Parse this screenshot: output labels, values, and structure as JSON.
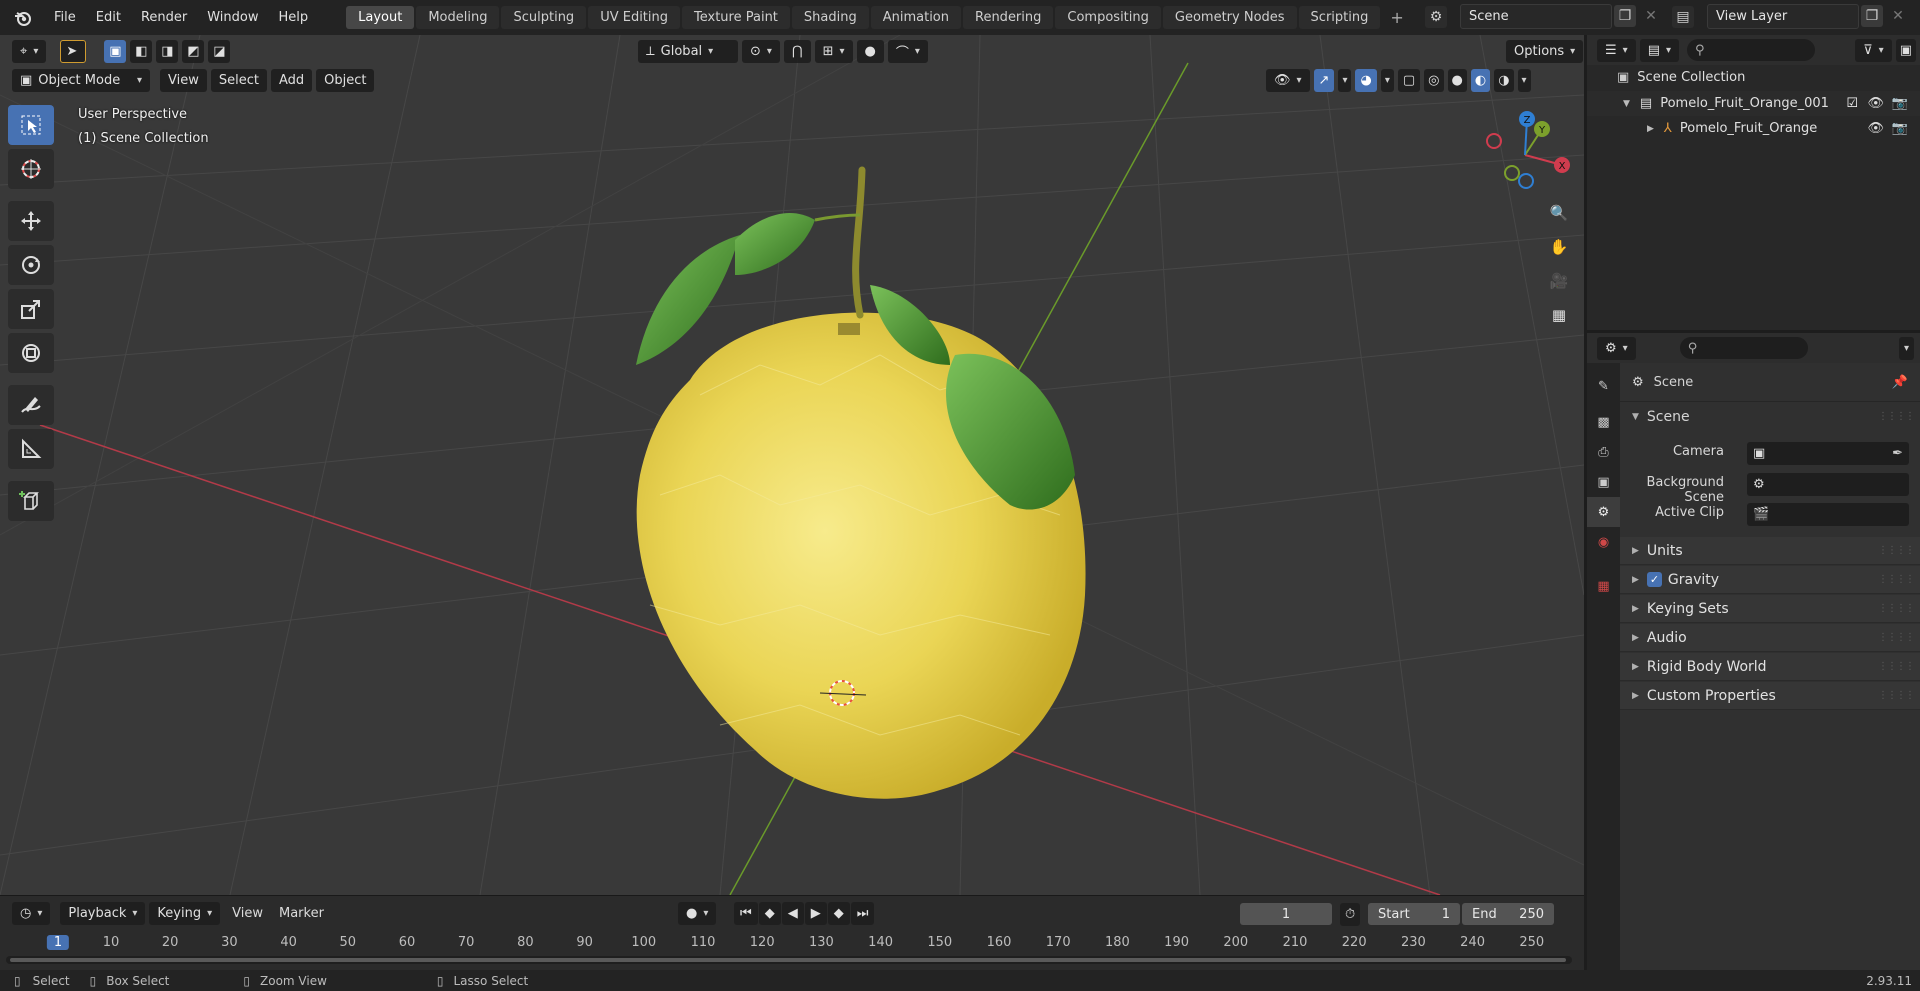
{
  "topbar": {
    "menus": [
      "File",
      "Edit",
      "Render",
      "Window",
      "Help"
    ],
    "workspaces": [
      "Layout",
      "Modeling",
      "Sculpting",
      "UV Editing",
      "Texture Paint",
      "Shading",
      "Animation",
      "Rendering",
      "Compositing",
      "Geometry Nodes",
      "Scripting"
    ],
    "active_workspace": "Layout",
    "scene_name": "Scene",
    "view_layer": "View Layer"
  },
  "viewport": {
    "transform_orientation": "Global",
    "options_label": "Options",
    "mode": "Object Mode",
    "menus": [
      "View",
      "Select",
      "Add",
      "Object"
    ],
    "perspective_text": "User Perspective",
    "collection_text": "(1) Scene Collection",
    "gizmo_axes": {
      "x": "X",
      "y": "Y",
      "z": "Z"
    }
  },
  "outliner": {
    "root": "Scene Collection",
    "collection": "Pomelo_Fruit_Orange_001",
    "object": "Pomelo_Fruit_Orange"
  },
  "properties": {
    "header": "Scene",
    "panel_scene": "Scene",
    "camera_label": "Camera",
    "background_scene_label": "Background Scene",
    "active_clip_label": "Active Clip",
    "panels": [
      "Units",
      "Gravity",
      "Keying Sets",
      "Audio",
      "Rigid Body World",
      "Custom Properties"
    ],
    "gravity_checked": true
  },
  "timeline": {
    "menus": [
      "Playback",
      "Keying",
      "View",
      "Marker"
    ],
    "current_frame": "1",
    "start_label": "Start",
    "start_value": "1",
    "end_label": "End",
    "end_value": "250",
    "ruler_marks": [
      "1",
      "10",
      "20",
      "30",
      "40",
      "50",
      "60",
      "70",
      "80",
      "90",
      "100",
      "110",
      "120",
      "130",
      "140",
      "150",
      "160",
      "170",
      "180",
      "190",
      "200",
      "210",
      "220",
      "230",
      "240",
      "250"
    ]
  },
  "statusbar": {
    "select": "Select",
    "box_select": "Box Select",
    "zoom_view": "Zoom View",
    "lasso_select": "Lasso Select",
    "version": "2.93.11"
  },
  "colors": {
    "accent": "#4772b3",
    "x_axis": "#d03c4e",
    "y_axis": "#7ca02c",
    "fruit": "#e8d448",
    "leaf": "#4d8f2f"
  }
}
